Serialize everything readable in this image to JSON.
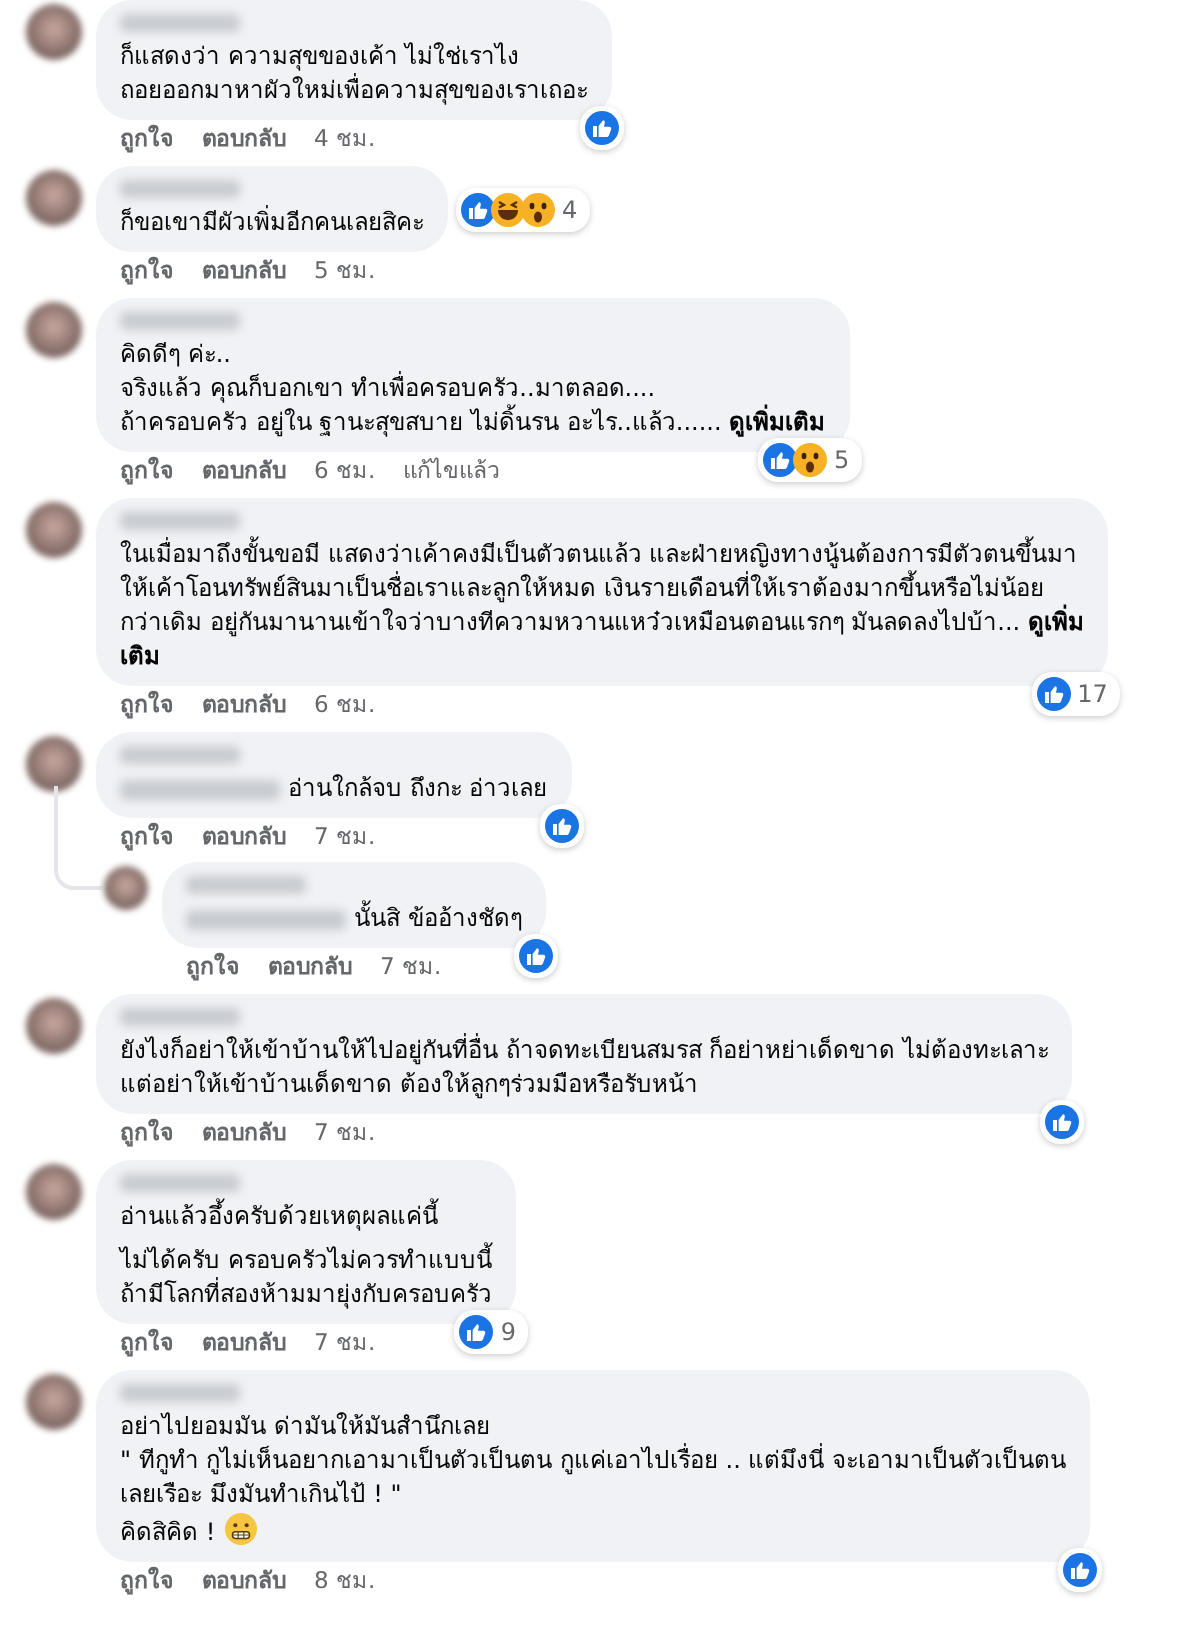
{
  "comments": [
    {
      "paragraphs": [
        "ก็แสดงว่า ความสุขของเค้า ไม่ใช่เราไง\nถอยออกมาหาผัวใหม่เพื่อความสุขของเราเถอะ"
      ],
      "reactions": [
        {
          "kind": "like"
        }
      ],
      "actions": {
        "like": "ถูกใจ",
        "reply": "ตอบกลับ",
        "time": "4 ชม."
      }
    },
    {
      "paragraphs": [
        "ก็ขอเขามีผัวเพิ่มอีกคนเลยสิคะ"
      ],
      "reactions": [
        {
          "kind": "like"
        },
        {
          "kind": "haha"
        },
        {
          "kind": "wow"
        }
      ],
      "reaction_count": "4",
      "reactions_inline": true,
      "actions": {
        "like": "ถูกใจ",
        "reply": "ตอบกลับ",
        "time": "5 ชม."
      }
    },
    {
      "paragraphs": [
        "คิดดีๆ ค่ะ..\nจริงแล้ว คุณก็บอกเขา ทำเพื่อครอบครัว..มาตลอด....\nถ้าครอบครัว อยู่ใน ฐานะสุขสบาย ไม่ดิ้นรน อะไร..แล้ว...... **ดูเพิ่มเติม**"
      ],
      "reactions": [
        {
          "kind": "like"
        },
        {
          "kind": "wow"
        }
      ],
      "reaction_count": "5",
      "actions": {
        "like": "ถูกใจ",
        "reply": "ตอบกลับ",
        "time": "6 ชม.",
        "edited": "แก้ไขแล้ว"
      }
    },
    {
      "paragraphs": [
        "ในเมื่อมาถึงขั้นขอมี แสดงว่าเค้าคงมีเป็นตัวตนแล้ว และฝ่ายหญิงทางนู้นต้องการมีตัวตนขึ้นมา\nให้เค้าโอนทรัพย์สินมาเป็นชื่อเราและลูกให้หมด เงินรายเดือนที่ให้เราต้องมากขึ้นหรือไม่น้อย\nกว่าเดิม อยู่กันมานานเข้าใจว่าบางทีความหวานแหว๋วเหมือนตอนแรกๆ มันลดลงไปบ้า... **ดูเพิ่ม\nเติม**"
      ],
      "reactions": [
        {
          "kind": "like"
        }
      ],
      "reaction_count": "17",
      "actions": {
        "like": "ถูกใจ",
        "reply": "ตอบกลับ",
        "time": "6 ชม."
      }
    },
    {
      "mention_blurred": true,
      "paragraphs": [
        "อ่านใกล้จบ ถึงกะ อ่าวเลย"
      ],
      "reactions": [
        {
          "kind": "like"
        }
      ],
      "actions": {
        "like": "ถูกใจ",
        "reply": "ตอบกลับ",
        "time": "7 ชม."
      },
      "replies": [
        {
          "mention_blurred": true,
          "paragraphs": [
            "นั้นสิ ข้ออ้างชัดๆ"
          ],
          "reactions": [
            {
              "kind": "like"
            }
          ],
          "actions": {
            "like": "ถูกใจ",
            "reply": "ตอบกลับ",
            "time": "7 ชม."
          }
        }
      ]
    },
    {
      "paragraphs": [
        "ยังไงก็อย่าให้เข้าบ้านให้ไปอยู่กันที่อื่น ถ้าจดทะเบียนสมรส ก็อย่าหย่าเด็ดขาด ไม่ต้องทะเลาะ\nแต่อย่าให้เข้าบ้านเด็ดขาด ต้องให้ลูกๆร่วมมือหรือรับหน้า"
      ],
      "reactions": [
        {
          "kind": "like"
        }
      ],
      "actions": {
        "like": "ถูกใจ",
        "reply": "ตอบกลับ",
        "time": "7 ชม."
      }
    },
    {
      "paragraphs": [
        "อ่านแล้วอึ้งครับด้วยเหตุผลแค่นี้",
        "ไม่ได้ครับ ครอบครัวไม่ควรทำแบบนี้\nถ้ามีโลกที่สองห้ามมายุ่งกับครอบครัว"
      ],
      "reactions": [
        {
          "kind": "like"
        }
      ],
      "reaction_count": "9",
      "actions": {
        "like": "ถูกใจ",
        "reply": "ตอบกลับ",
        "time": "7 ชม."
      }
    },
    {
      "paragraphs": [
        "อย่าไปยอมมัน ด่ามันให้มันสำนึกเลย\n\" ทีกูทำ กูไม่เห็นอยากเอามาเป็นตัวเป็นตน กูแค่เอาไปเรื่อย .. แต่มึงนี่ จะเอามาเป็นตัวเป็นตน\nเลยเรือะ มึงมันทำเกินไป้ ! \"\nคิดสิคิด !"
      ],
      "trailing_emoji": {
        "kind": "grimace"
      },
      "reactions": [
        {
          "kind": "like"
        }
      ],
      "actions": {
        "like": "ถูกใจ",
        "reply": "ตอบกลับ",
        "time": "8 ชม."
      }
    }
  ]
}
